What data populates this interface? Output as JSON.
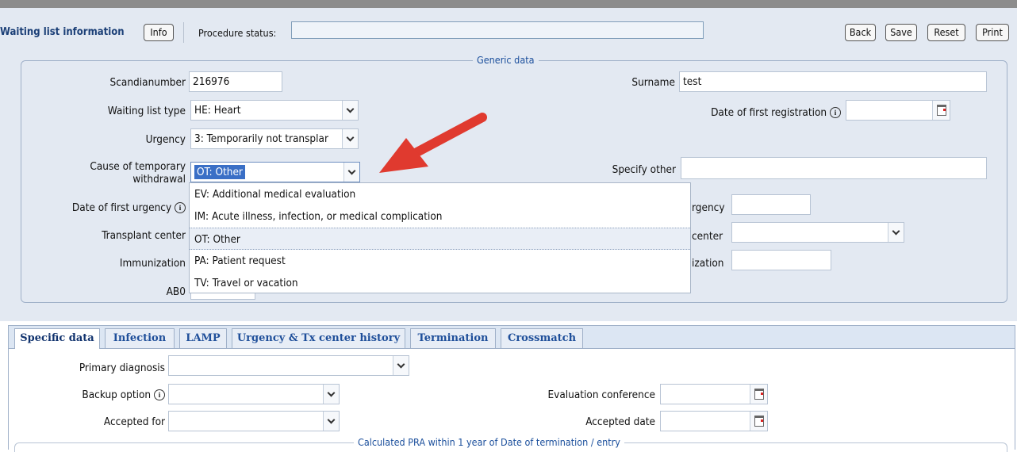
{
  "toolbar": {
    "title": "Waiting list information",
    "info_button": "Info",
    "procedure_status_label": "Procedure status:",
    "procedure_status_value": "",
    "back_button": "Back",
    "save_button": "Save",
    "reset_button": "Reset",
    "print_button": "Print"
  },
  "generic": {
    "legend": "Generic data",
    "scandianumber_label": "Scandianumber",
    "scandianumber_value": "216976",
    "surname_label": "Surname",
    "surname_value": "test",
    "waiting_list_type_label": "Waiting list type",
    "waiting_list_type_value": "HE: Heart",
    "date_first_registration_label": "Date of first registration",
    "date_first_registration_value": "",
    "urgency_label": "Urgency",
    "urgency_value": "3: Temporarily not transplar",
    "cause_label_line1": "Cause of temporary",
    "cause_label_line2": "withdrawal",
    "cause_value": "OT: Other",
    "specify_other_label": "Specify other",
    "specify_other_value": "",
    "date_first_urgency_label": "Date of first urgency",
    "date_urgency_label_partial": "rgency",
    "transplant_center_label": "Transplant center",
    "center_label_partial": "center",
    "immunization_label": "Immunization",
    "immunization_partial": "ization",
    "ab0_label": "AB0"
  },
  "cause_dropdown": {
    "options": [
      {
        "label": "EV: Additional medical evaluation",
        "selected": false
      },
      {
        "label": "IM: Acute illness, infection, or medical complication",
        "selected": false
      },
      {
        "label": "OT: Other",
        "selected": true
      },
      {
        "label": "PA: Patient request",
        "selected": false
      },
      {
        "label": "TV: Travel or vacation",
        "selected": false
      }
    ]
  },
  "tabs": [
    {
      "label": "Specific data",
      "active": true
    },
    {
      "label": "Infection",
      "active": false
    },
    {
      "label": "LAMP",
      "active": false
    },
    {
      "label": "Urgency & Tx center history",
      "active": false
    },
    {
      "label": "Termination",
      "active": false
    },
    {
      "label": "Crossmatch",
      "active": false
    }
  ],
  "specific": {
    "primary_diagnosis_label": "Primary diagnosis",
    "primary_diagnosis_value": "",
    "backup_option_label": "Backup option",
    "backup_option_value": "",
    "evaluation_conference_label": "Evaluation conference",
    "evaluation_conference_value": "",
    "accepted_for_label": "Accepted for",
    "accepted_for_value": "",
    "accepted_date_label": "Accepted date",
    "accepted_date_value": "",
    "calculated_pra_legend": "Calculated PRA within 1 year of Date of termination / entry"
  },
  "colors": {
    "panel_bg": "#e3e9f2",
    "legend_blue": "#1b4f9c",
    "highlight_blue": "#3a6fc6",
    "arrow_red": "#e03a2f"
  },
  "icons": [
    "info-icon",
    "calendar-icon",
    "chevron-down-icon",
    "red-arrow-annotation"
  ]
}
